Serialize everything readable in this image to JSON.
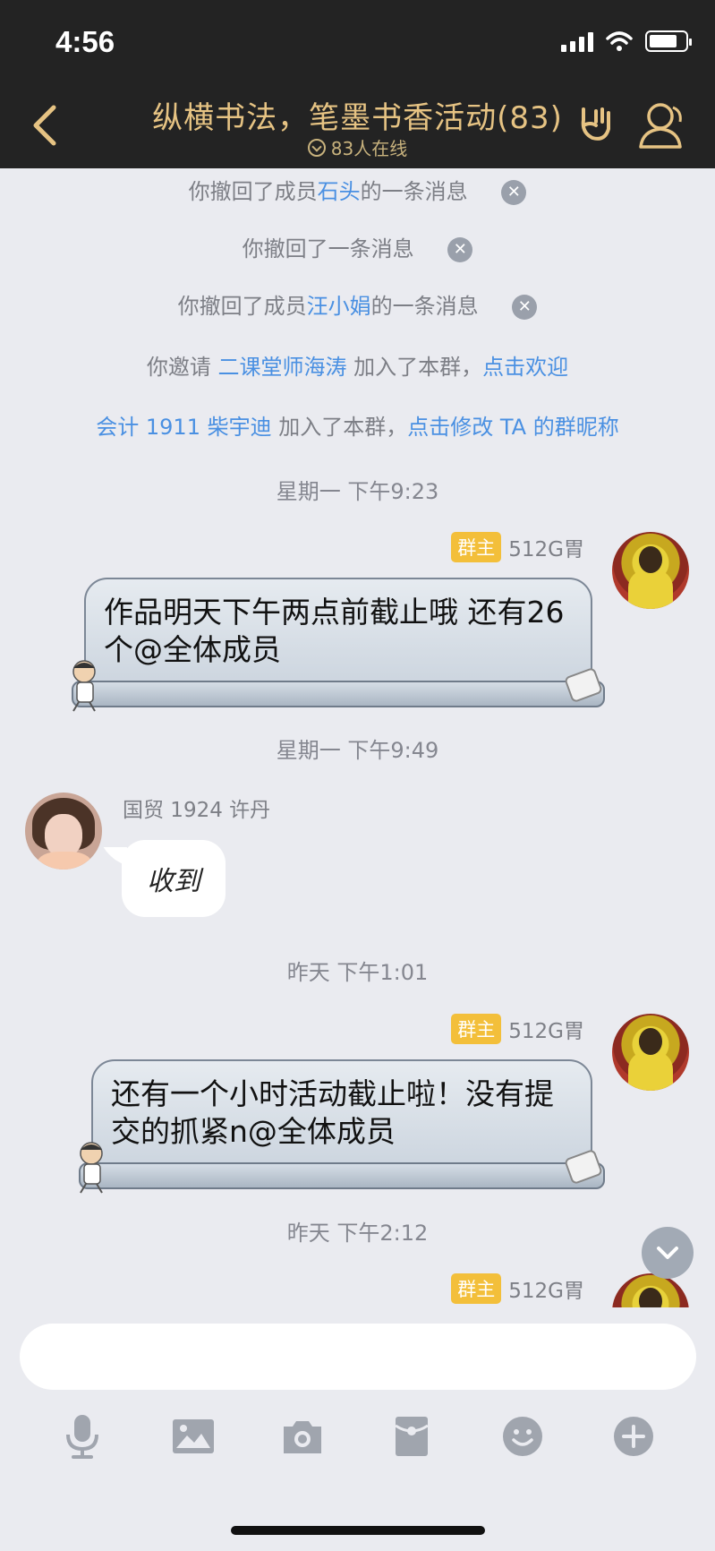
{
  "status_bar": {
    "time": "4:56"
  },
  "header": {
    "title": "纵横书法，笔墨书香活动(83)",
    "online": "83人在线"
  },
  "system_messages": [
    {
      "prefix": "你撤回了成员",
      "link": "石头",
      "suffix": "的一条消息",
      "close": "✕"
    },
    {
      "prefix": "你撤回了一条消息",
      "link": "",
      "suffix": "",
      "close": "✕"
    },
    {
      "prefix": "你撤回了成员",
      "link": "汪小娟",
      "suffix": "的一条消息",
      "close": "✕"
    },
    {
      "prefix": "你邀请 ",
      "link": "二课堂师海涛",
      "suffix": " 加入了本群，",
      "link2": "点击欢迎"
    },
    {
      "prefix": "",
      "link": "会计 1911 柴宇迪",
      "suffix": " 加入了本群，",
      "link2": "点击修改 TA 的群昵称"
    }
  ],
  "timestamps": [
    "星期一 下午9:23",
    "星期一 下午9:49",
    "昨天 下午1:01",
    "昨天 下午2:12"
  ],
  "messages": [
    {
      "badge": "群主",
      "sender": "512G胃",
      "text": "作品明天下午两点前截止哦 还有26个@全体成员"
    },
    {
      "sender": "国贸 1924 许丹",
      "text": "收到"
    },
    {
      "badge": "群主",
      "sender": "512G胃",
      "text": "还有一个小时活动截止啦！没有提交的抓紧n@全体成员"
    },
    {
      "badge": "群主",
      "sender": "512G胃"
    }
  ],
  "input": {
    "placeholder": ""
  },
  "toolbar": [
    "mic-icon",
    "image-icon",
    "camera-icon",
    "red-packet-icon",
    "emoji-icon",
    "plus-icon"
  ]
}
